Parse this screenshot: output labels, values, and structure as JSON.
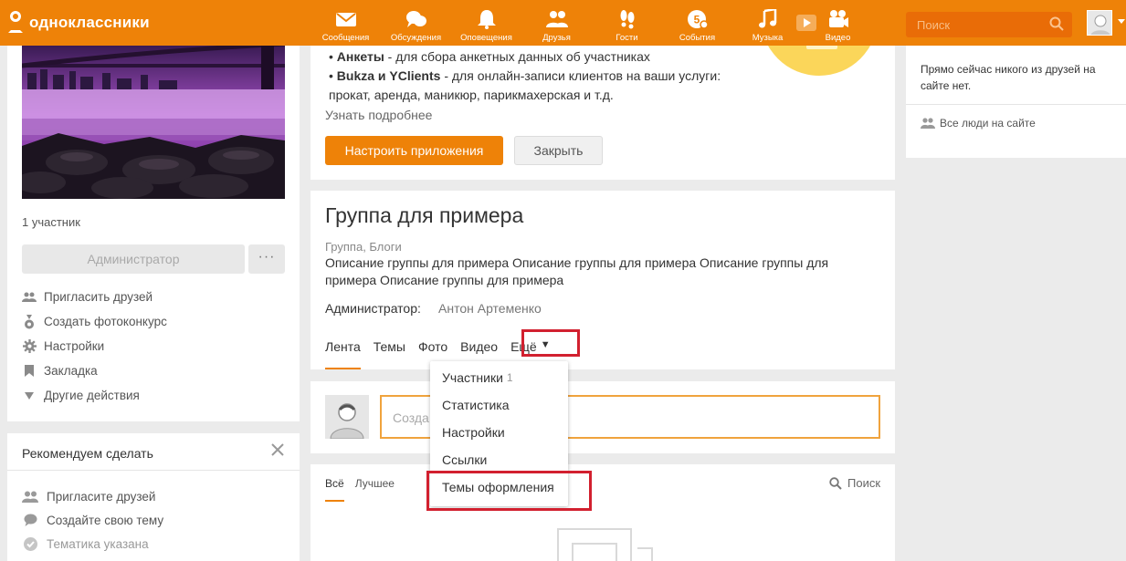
{
  "topbar": {
    "logo": "одноклассники",
    "nav": [
      {
        "label": "Сообщения",
        "icon": "envelope-icon"
      },
      {
        "label": "Обсуждения",
        "icon": "chat-icon"
      },
      {
        "label": "Оповещения",
        "icon": "bell-icon"
      },
      {
        "label": "Друзья",
        "icon": "friends-icon"
      },
      {
        "label": "Гости",
        "icon": "footprints-icon"
      },
      {
        "label": "События",
        "icon": "coin-icon"
      },
      {
        "label": "Музыка",
        "icon": "music-note-icon"
      },
      {
        "label": "Видео",
        "icon": "video-camera-icon"
      }
    ],
    "search_placeholder": "Поиск"
  },
  "left": {
    "members": "1 участник",
    "admin_button": "Администратор",
    "more_button": "···",
    "menu": [
      {
        "label": "Пригласить друзей",
        "icon": "invite-friends-icon"
      },
      {
        "label": "Создать фотоконкурс",
        "icon": "medal-icon"
      },
      {
        "label": "Настройки",
        "icon": "gear-icon"
      },
      {
        "label": "Закладка",
        "icon": "bookmark-icon"
      },
      {
        "label": "Другие действия",
        "icon": "triangle-down-icon"
      }
    ],
    "recommend": {
      "title": "Рекомендуем сделать",
      "items": [
        {
          "label": "Пригласите друзей",
          "icon": "people-icon",
          "done": false
        },
        {
          "label": "Создайте свою тему",
          "icon": "speech-bubble-icon",
          "done": false
        },
        {
          "label": "Тематика указана",
          "icon": "checkmark-icon",
          "done": true
        }
      ]
    }
  },
  "apps": {
    "line1_bold": "Анкеты",
    "line1_rest": " - для сбора анкетных данных об участниках",
    "line2_bold": "Bukza и YClients",
    "line2_rest": " - для онлайн-записи клиентов на ваши услуги:",
    "line3": "прокат, аренда, маникюр, парикмахерская и т.д.",
    "learn_more": "Узнать подробнее",
    "setup_button": "Настроить приложения",
    "close_button": "Закрыть"
  },
  "group": {
    "title": "Группа для примера",
    "category": "Группа, Блоги",
    "description": "Описание группы для примера Описание группы для примера Описание группы для примера Описание группы для примера",
    "admin_label": "Администратор:",
    "admin_name": "Антон Артеменко",
    "tabs": [
      "Лента",
      "Темы",
      "Фото",
      "Видео"
    ],
    "more_tab": "Ещё",
    "more_caret": "▼"
  },
  "post": {
    "placeholder": "Созда"
  },
  "feed": {
    "tabs": [
      "Всё",
      "Лучшее"
    ],
    "search": "Поиск"
  },
  "dropdown": {
    "items": [
      {
        "label": "Участники",
        "count": "1"
      },
      {
        "label": "Статистика",
        "count": ""
      },
      {
        "label": "Настройки",
        "count": ""
      },
      {
        "label": "Ссылки",
        "count": ""
      },
      {
        "label": "Темы оформления",
        "count": ""
      }
    ]
  },
  "right": {
    "online_text": "Прямо сейчас никого из друзей на сайте нет.",
    "all_people": "Все люди на сайте"
  },
  "colors": {
    "brand_orange": "#ee8208",
    "highlight_red": "#d2202f"
  }
}
